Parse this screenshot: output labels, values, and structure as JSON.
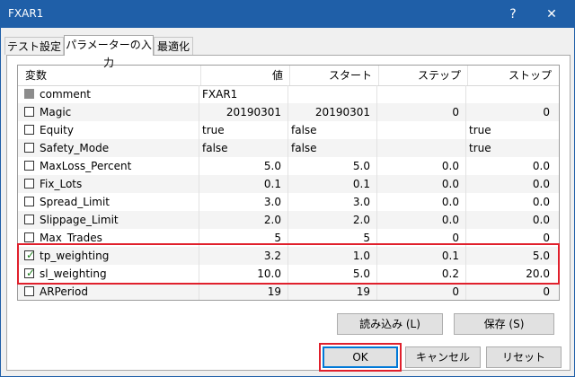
{
  "window": {
    "title": "FXAR1",
    "help": "?",
    "close": "✕"
  },
  "tabs": [
    {
      "label": "テスト設定"
    },
    {
      "label": "パラメーターの入力"
    },
    {
      "label": "最適化"
    }
  ],
  "table": {
    "headers": {
      "var": "変数",
      "value": "値",
      "start": "スタート",
      "step": "ステップ",
      "stop": "ストップ"
    },
    "rows": [
      {
        "name": "comment",
        "value": "FXAR1",
        "start": "",
        "step": "",
        "stop": "",
        "checked": false,
        "disabled": true
      },
      {
        "name": "Magic",
        "value": "20190301",
        "start": "20190301",
        "step": "0",
        "stop": "0",
        "checked": false
      },
      {
        "name": "Equity",
        "value": "true",
        "start": "false",
        "step": "",
        "stop": "true",
        "checked": false
      },
      {
        "name": "Safety_Mode",
        "value": "false",
        "start": "false",
        "step": "",
        "stop": "true",
        "checked": false
      },
      {
        "name": "MaxLoss_Percent",
        "value": "5.0",
        "start": "5.0",
        "step": "0.0",
        "stop": "0.0",
        "checked": false
      },
      {
        "name": "Fix_Lots",
        "value": "0.1",
        "start": "0.1",
        "step": "0.0",
        "stop": "0.0",
        "checked": false
      },
      {
        "name": "Spread_Limit",
        "value": "3.0",
        "start": "3.0",
        "step": "0.0",
        "stop": "0.0",
        "checked": false
      },
      {
        "name": "Slippage_Limit",
        "value": "2.0",
        "start": "2.0",
        "step": "0.0",
        "stop": "0.0",
        "checked": false
      },
      {
        "name": "Max_Trades",
        "value": "5",
        "start": "5",
        "step": "0",
        "stop": "0",
        "checked": false
      },
      {
        "name": "tp_weighting",
        "value": "3.2",
        "start": "1.0",
        "step": "0.1",
        "stop": "5.0",
        "checked": true
      },
      {
        "name": "sl_weighting",
        "value": "10.0",
        "start": "5.0",
        "step": "0.2",
        "stop": "20.0",
        "checked": true
      },
      {
        "name": "ARPeriod",
        "value": "19",
        "start": "19",
        "step": "0",
        "stop": "0",
        "checked": false
      }
    ]
  },
  "buttons": {
    "load": "読み込み (L)",
    "save": "保存 (S)",
    "ok": "OK",
    "cancel": "キャンセル",
    "reset": "リセット"
  },
  "colors": {
    "titlebar": "#1f5fa8",
    "highlight": "#e0202c",
    "check": "#1e7f1e"
  }
}
